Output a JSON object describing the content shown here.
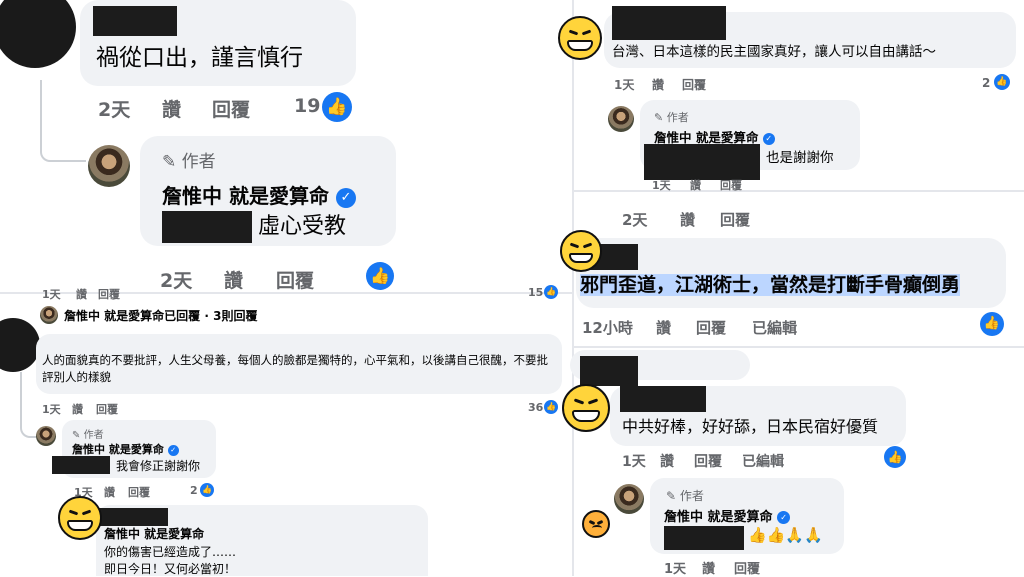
{
  "panel_tl": {
    "comment": "禍從口出，謹言慎行",
    "actions": {
      "time": "2天",
      "like": "讚",
      "reply": "回覆",
      "count": "19"
    },
    "reply": {
      "author_badge": "作者",
      "author": "詹惟中 就是愛算命",
      "text": "虛心受教",
      "actions": {
        "time": "2天",
        "like": "讚",
        "reply": "回覆"
      }
    }
  },
  "panel_bl": {
    "top_actions": {
      "time": "1天",
      "like": "讚",
      "reply": "回覆",
      "count": "15"
    },
    "replied_line": "詹惟中 就是愛算命已回覆 · 3則回覆",
    "comment": "人的面貌真的不要批評，人生父母養，每個人的臉都是獨特的，心平氣和，以後講自己很醜，不要批評別人的樣貌",
    "actions": {
      "time": "1天",
      "like": "讚",
      "reply": "回覆",
      "count": "36"
    },
    "reply": {
      "author_badge": "作者",
      "author": "詹惟中 就是愛算命",
      "text": "我會修正謝謝你",
      "actions": {
        "time": "1天",
        "like": "讚",
        "reply": "回覆",
        "count": "2"
      }
    },
    "sub_reply": {
      "author": "詹惟中 就是愛算命",
      "line1": "你的傷害已經造成了……",
      "line2": "即日今日！又何必當初！"
    }
  },
  "panel_tr": {
    "comment": "台灣、日本這樣的民主國家真好，讓人可以自由講話～",
    "actions": {
      "time": "1天",
      "like": "讚",
      "reply": "回覆",
      "count": "2"
    },
    "reply": {
      "author_badge": "作者",
      "author": "詹惟中 就是愛算命",
      "text": "也是謝謝你",
      "actions": {
        "time": "1天",
        "like": "讚",
        "reply": "回覆"
      }
    },
    "bottom_actions": {
      "time": "2天",
      "like": "讚",
      "reply": "回覆"
    }
  },
  "panel_mr": {
    "comment": "邪門歪道，江湖術士，當然是打斷手骨癲倒勇",
    "actions": {
      "time": "12小時",
      "like": "讚",
      "reply": "回覆",
      "edited": "已編輯"
    }
  },
  "panel_br": {
    "comment": "中共好棒，好好舔，日本民宿好優質",
    "actions": {
      "time": "1天",
      "like": "讚",
      "reply": "回覆",
      "edited": "已編輯"
    },
    "reply": {
      "author_badge": "作者",
      "author": "詹惟中 就是愛算命",
      "emojis": "👍👍🙏🙏",
      "actions": {
        "time": "1天",
        "like": "讚",
        "reply": "回覆"
      }
    }
  },
  "icons": {
    "like": "👍",
    "pencil": "✎",
    "verified": "✓"
  },
  "colors": {
    "facebook_blue": "#1877f2",
    "bubble": "#f0f2f5",
    "meta_text": "#65676b",
    "highlight": "#bcd6ff"
  }
}
